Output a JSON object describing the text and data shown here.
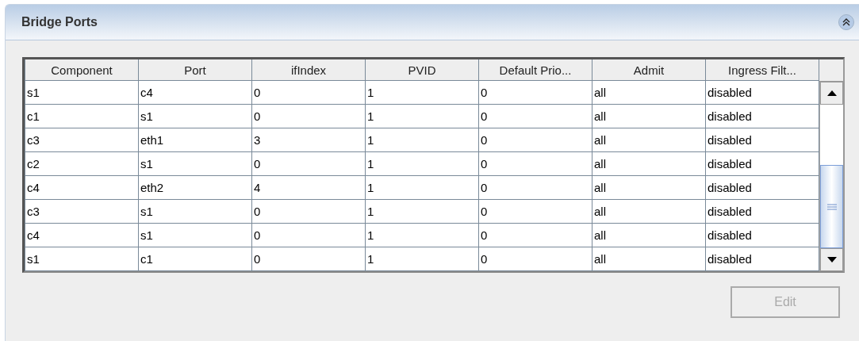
{
  "panel": {
    "title": "Bridge Ports",
    "expanded": true
  },
  "table": {
    "columns": [
      "Component",
      "Port",
      "ifIndex",
      "PVID",
      "Default Prio...",
      "Admit",
      "Ingress Filt..."
    ],
    "rows": [
      [
        "s1",
        "c4",
        "0",
        "1",
        "0",
        "all",
        "disabled"
      ],
      [
        "c1",
        "s1",
        "0",
        "1",
        "0",
        "all",
        "disabled"
      ],
      [
        "c3",
        "eth1",
        "3",
        "1",
        "0",
        "all",
        "disabled"
      ],
      [
        "c2",
        "s1",
        "0",
        "1",
        "0",
        "all",
        "disabled"
      ],
      [
        "c4",
        "eth2",
        "4",
        "1",
        "0",
        "all",
        "disabled"
      ],
      [
        "c3",
        "s1",
        "0",
        "1",
        "0",
        "all",
        "disabled"
      ],
      [
        "c4",
        "s1",
        "0",
        "1",
        "0",
        "all",
        "disabled"
      ],
      [
        "s1",
        "c1",
        "0",
        "1",
        "0",
        "all",
        "disabled"
      ]
    ]
  },
  "buttons": [
    {
      "label": "Edit",
      "disabled": true
    }
  ]
}
